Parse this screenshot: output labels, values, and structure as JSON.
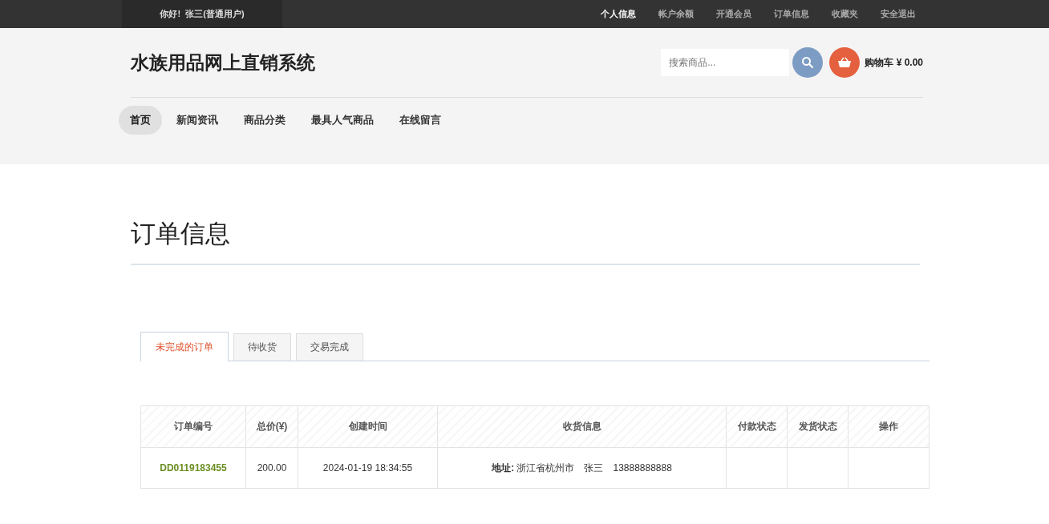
{
  "top_bar": {
    "greeting": "你好!  张三(普通用户)",
    "links": [
      {
        "label": "个人信息",
        "selected": true
      },
      {
        "label": "帐户余额",
        "selected": false
      },
      {
        "label": "开通会员",
        "selected": false
      },
      {
        "label": "订单信息",
        "selected": false
      },
      {
        "label": "收藏夹",
        "selected": false
      },
      {
        "label": "安全退出",
        "selected": false
      }
    ]
  },
  "header": {
    "site_title": "水族用品网上直销系统",
    "search": {
      "placeholder": "搜索商品..."
    },
    "cart": "购物车 ¥ 0.00"
  },
  "nav": [
    {
      "label": "首页",
      "selected": true
    },
    {
      "label": "新闻资讯",
      "selected": false
    },
    {
      "label": "商品分类",
      "selected": false
    },
    {
      "label": "最具人气商品",
      "selected": false
    },
    {
      "label": "在线留言",
      "selected": false
    }
  ],
  "page_title": "订单信息",
  "tabs": [
    {
      "label": "未完成的订单",
      "selected": true
    },
    {
      "label": "待收货",
      "selected": false
    },
    {
      "label": "交易完成",
      "selected": false
    }
  ],
  "table": {
    "columns": [
      "订单编号",
      "总价(¥)",
      "创建时间",
      "收货信息",
      "付款状态",
      "发货状态",
      "操作"
    ],
    "rows": [
      {
        "order_no": "DD0119183455",
        "total": "200.00",
        "created": "2024-01-19 18:34:55",
        "shipping": "**地址:** 浙江省杭州市　张三　13888888888"
      }
    ]
  }
}
